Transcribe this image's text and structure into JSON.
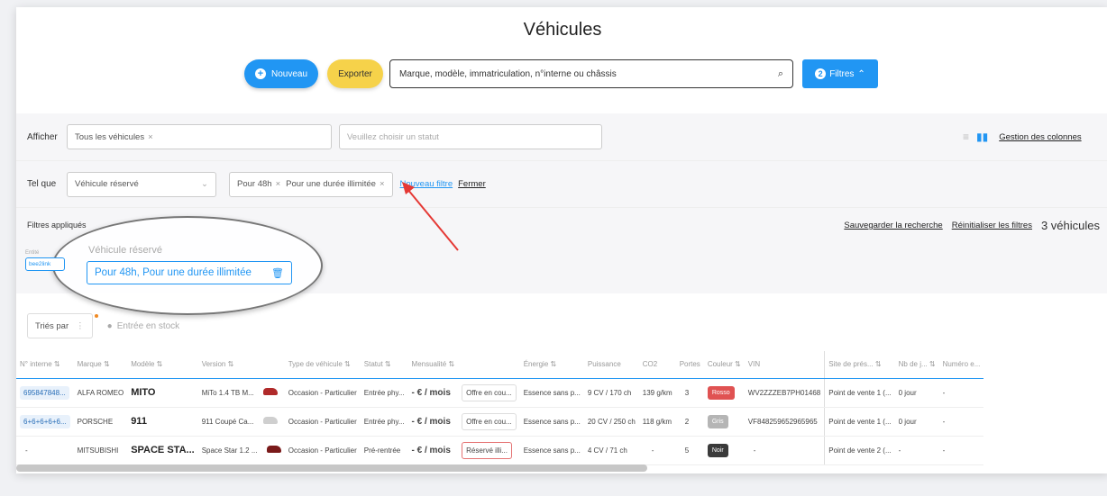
{
  "page": {
    "title": "Véhicules"
  },
  "toolbar": {
    "new_label": "Nouveau",
    "export_label": "Exporter",
    "search_placeholder": "Marque, modèle, immatriculation, n°interne ou châssis",
    "filters_label": "Filtres",
    "filters_count": "2"
  },
  "afficher": {
    "label": "Afficher",
    "selected": "Tous les véhicules",
    "status_placeholder": "Veuillez choisir un statut",
    "columns_link": "Gestion des colonnes"
  },
  "telque": {
    "label": "Tel que",
    "selected": "Véhicule réservé",
    "chips": [
      "Pour 48h",
      "Pour une durée illimitée"
    ],
    "new_filter": "Nouveau filtre",
    "close": "Fermer"
  },
  "applied": {
    "label": "Filtres appliqués",
    "entity_label": "Entité",
    "entity_value": "bee2link",
    "filter_title": "Véhicule réservé",
    "filter_value": "Pour 48h, Pour une durée illimitée",
    "save_search": "Sauvegarder la recherche",
    "reset_filters": "Réinitialiser les filtres",
    "count": "3 véhicules"
  },
  "sort": {
    "label": "Triés par",
    "entry": "Entrée en stock"
  },
  "table": {
    "headers": [
      "N° interne",
      "Marque",
      "Modèle",
      "Version",
      "Type de véhicule",
      "Statut",
      "Mensualité",
      "",
      "Énergie",
      "Puissance",
      "CO2",
      "Portes",
      "Couleur",
      "VIN",
      "Site de prés...",
      "Nb de j...",
      "Numéro e..."
    ],
    "rows": [
      {
        "id": "695847848...",
        "brand": "ALFA ROMEO",
        "model": "MITO",
        "version": "MiTo 1.4 TB M...",
        "type": "Occasion - Particulier",
        "status": "Entrée phy...",
        "monthly": "- € / mois",
        "offer": "Offre en cou...",
        "energy": "Essence sans p...",
        "power": "9 CV / 170 ch",
        "co2": "139 g/km",
        "doors": "3",
        "color": "Rosso",
        "color_hex": "#e05252",
        "vin": "WV2ZZZEB7PH01468",
        "site": "Point de vente 1 (...",
        "days": "0 jour",
        "num": "-",
        "car_hex": "#b02a2a"
      },
      {
        "id": "6+6+6+6+6...",
        "brand": "PORSCHE",
        "model": "911",
        "version": "911 Coupé Ca...",
        "type": "Occasion - Particulier",
        "status": "Entrée phy...",
        "monthly": "- € / mois",
        "offer": "Offre en cou...",
        "energy": "Essence sans p...",
        "power": "20 CV / 250 ch",
        "co2": "118 g/km",
        "doors": "2",
        "color": "Gris",
        "color_hex": "#b5b5b5",
        "vin": "VF848259652965965",
        "site": "Point de vente 1 (...",
        "days": "0 jour",
        "num": "-",
        "car_hex": "#cfcfcf"
      },
      {
        "id": "-",
        "brand": "MITSUBISHI",
        "model": "SPACE STA...",
        "version": "Space Star 1.2 ...",
        "type": "Occasion - Particulier",
        "status": "Pré-rentrée",
        "monthly": "- € / mois",
        "offer": "Réservé illi...",
        "energy": "Essence sans p...",
        "power": "4 CV / 71 ch",
        "co2": "-",
        "doors": "5",
        "color": "Noir",
        "color_hex": "#3a3a3a",
        "vin": "-",
        "site": "Point de vente 2 (...",
        "days": "-",
        "num": "-",
        "car_hex": "#7a1a1a"
      }
    ]
  },
  "colors": {
    "primary": "#2196f3",
    "export": "#f6d24a",
    "arrow": "#e53935"
  }
}
